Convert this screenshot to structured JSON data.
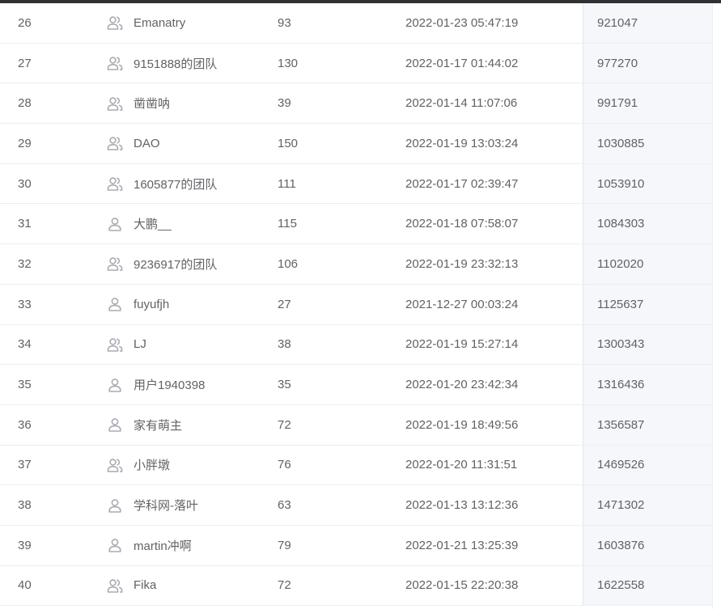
{
  "rows": [
    {
      "rank": "26",
      "type": "team-icon",
      "name": "Emanatry",
      "count": "93",
      "time": "2022-01-23 05:47:19",
      "score": "921047"
    },
    {
      "rank": "27",
      "type": "team-icon",
      "name": "9151888的团队",
      "count": "130",
      "time": "2022-01-17 01:44:02",
      "score": "977270"
    },
    {
      "rank": "28",
      "type": "team-icon",
      "name": "凿凿呐",
      "count": "39",
      "time": "2022-01-14 11:07:06",
      "score": "991791"
    },
    {
      "rank": "29",
      "type": "team-icon",
      "name": "DAO",
      "count": "150",
      "time": "2022-01-19 13:03:24",
      "score": "1030885"
    },
    {
      "rank": "30",
      "type": "team-icon",
      "name": "1605877的团队",
      "count": "111",
      "time": "2022-01-17 02:39:47",
      "score": "1053910"
    },
    {
      "rank": "31",
      "type": "user-icon",
      "name": "大鹏__",
      "count": "115",
      "time": "2022-01-18 07:58:07",
      "score": "1084303"
    },
    {
      "rank": "32",
      "type": "team-icon",
      "name": "9236917的团队",
      "count": "106",
      "time": "2022-01-19 23:32:13",
      "score": "1102020"
    },
    {
      "rank": "33",
      "type": "user-icon",
      "name": "fuyufjh",
      "count": "27",
      "time": "2021-12-27 00:03:24",
      "score": "1125637"
    },
    {
      "rank": "34",
      "type": "team-icon",
      "name": "LJ",
      "count": "38",
      "time": "2022-01-19 15:27:14",
      "score": "1300343"
    },
    {
      "rank": "35",
      "type": "user-icon",
      "name": "用户1940398",
      "count": "35",
      "time": "2022-01-20 23:42:34",
      "score": "1316436"
    },
    {
      "rank": "36",
      "type": "user-icon",
      "name": "家有萌主",
      "count": "72",
      "time": "2022-01-19 18:49:56",
      "score": "1356587"
    },
    {
      "rank": "37",
      "type": "team-icon",
      "name": "小胖墩",
      "count": "76",
      "time": "2022-01-20 11:31:51",
      "score": "1469526"
    },
    {
      "rank": "38",
      "type": "user-icon",
      "name": "学科网-落叶",
      "count": "63",
      "time": "2022-01-13 13:12:36",
      "score": "1471302"
    },
    {
      "rank": "39",
      "type": "user-icon",
      "name": "martin冲啊",
      "count": "79",
      "time": "2022-01-21 13:25:39",
      "score": "1603876"
    },
    {
      "rank": "40",
      "type": "team-icon",
      "name": "Fika",
      "count": "72",
      "time": "2022-01-15 22:20:38",
      "score": "1622558"
    }
  ],
  "colors": {
    "text": "#606266",
    "border": "#ebeef5",
    "highlight_column": "#f5f7fa",
    "icon": "#a8abb2",
    "topbar": "#303133"
  }
}
